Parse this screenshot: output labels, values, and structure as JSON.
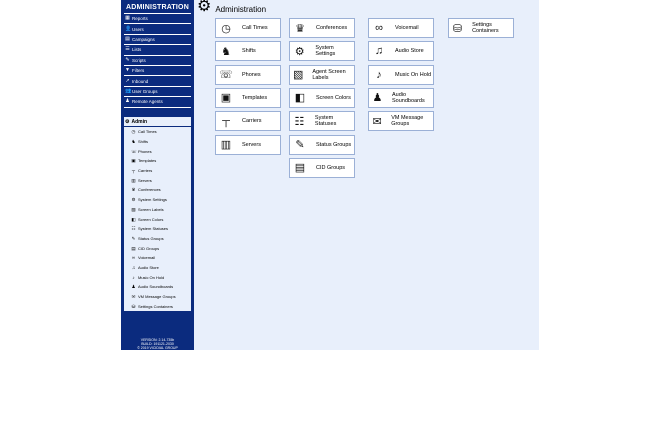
{
  "sidebar": {
    "title": "ADMINISTRATION",
    "items": [
      {
        "label": "Reports",
        "icon": "reports-icon",
        "glyph": "▦"
      },
      {
        "label": "Users",
        "icon": "users-icon",
        "glyph": "👤"
      },
      {
        "label": "Campaigns",
        "icon": "campaigns-icon",
        "glyph": "▤"
      },
      {
        "label": "Lists",
        "icon": "lists-icon",
        "glyph": "☰"
      },
      {
        "label": "Scripts",
        "icon": "scripts-icon",
        "glyph": "✎"
      },
      {
        "label": "Filters",
        "icon": "filters-icon",
        "glyph": "▼"
      },
      {
        "label": "Inbound",
        "icon": "inbound-icon",
        "glyph": "↗"
      },
      {
        "label": "User Groups",
        "icon": "user-groups-icon",
        "glyph": "👥"
      },
      {
        "label": "Remote Agents",
        "icon": "remote-agents-icon",
        "glyph": "♟"
      }
    ],
    "admin_label": "Admin",
    "sub_items": [
      {
        "label": "Call Times",
        "glyph": "◷"
      },
      {
        "label": "Shifts",
        "glyph": "♞"
      },
      {
        "label": "Phones",
        "glyph": "☏"
      },
      {
        "label": "Templates",
        "glyph": "▣"
      },
      {
        "label": "Carriers",
        "glyph": "┬"
      },
      {
        "label": "Servers",
        "glyph": "▥"
      },
      {
        "label": "Conferences",
        "glyph": "♛"
      },
      {
        "label": "System Settings",
        "glyph": "⚙"
      },
      {
        "label": "Screen Labels",
        "glyph": "▧"
      },
      {
        "label": "Screen Colors",
        "glyph": "◧"
      },
      {
        "label": "System Statuses",
        "glyph": "☷"
      },
      {
        "label": "Status Groups",
        "glyph": "✎"
      },
      {
        "label": "CID Groups",
        "glyph": "▤"
      },
      {
        "label": "Voicemail",
        "glyph": "∞"
      },
      {
        "label": "Audio Store",
        "glyph": "♫"
      },
      {
        "label": "Music On Hold",
        "glyph": "♪"
      },
      {
        "label": "Audio Soundboards",
        "glyph": "♟"
      },
      {
        "label": "VM Message Groups",
        "glyph": "✉"
      },
      {
        "label": "Settings Containers",
        "glyph": "⛁"
      }
    ],
    "version_lines": [
      "VERSION: 2.14-735b",
      "BUILD: 191121-2030",
      "© 2019 VICIDIAL GROUP"
    ]
  },
  "header": {
    "title": "Administration"
  },
  "cards": [
    {
      "label": "Call Times",
      "glyph": "◷",
      "col": 0,
      "row": 0
    },
    {
      "label": "Shifts",
      "glyph": "♞",
      "col": 0,
      "row": 1
    },
    {
      "label": "Phones",
      "glyph": "☏",
      "col": 0,
      "row": 2
    },
    {
      "label": "Templates",
      "glyph": "▣",
      "col": 0,
      "row": 3
    },
    {
      "label": "Carriers",
      "glyph": "┬",
      "col": 0,
      "row": 4
    },
    {
      "label": "Servers",
      "glyph": "▥",
      "col": 0,
      "row": 5
    },
    {
      "label": "Conferences",
      "glyph": "♛",
      "col": 1,
      "row": 0
    },
    {
      "label": "System Settings",
      "glyph": "⚙",
      "col": 1,
      "row": 1
    },
    {
      "label": "Agent Screen Labels",
      "glyph": "▧",
      "col": 1,
      "row": 2
    },
    {
      "label": "Screen Colors",
      "glyph": "◧",
      "col": 1,
      "row": 3
    },
    {
      "label": "System Statuses",
      "glyph": "☷",
      "col": 1,
      "row": 4
    },
    {
      "label": "Status Groups",
      "glyph": "✎",
      "col": 1,
      "row": 5
    },
    {
      "label": "CID Groups",
      "glyph": "▤",
      "col": 1,
      "row": 6
    },
    {
      "label": "Voicemail",
      "glyph": "∞",
      "col": 2,
      "row": 0
    },
    {
      "label": "Audio Store",
      "glyph": "♫",
      "col": 2,
      "row": 1
    },
    {
      "label": "Music On Hold",
      "glyph": "♪",
      "col": 2,
      "row": 2
    },
    {
      "label": "Audio Soundboards",
      "glyph": "♟",
      "col": 2,
      "row": 3
    },
    {
      "label": "VM Message Groups",
      "glyph": "✉",
      "col": 2,
      "row": 4
    },
    {
      "label": "Settings Containers",
      "glyph": "⛁",
      "col": 3,
      "row": 0
    }
  ],
  "colors": {
    "sidebar": "#0b2b7e",
    "background": "#e8effb"
  }
}
